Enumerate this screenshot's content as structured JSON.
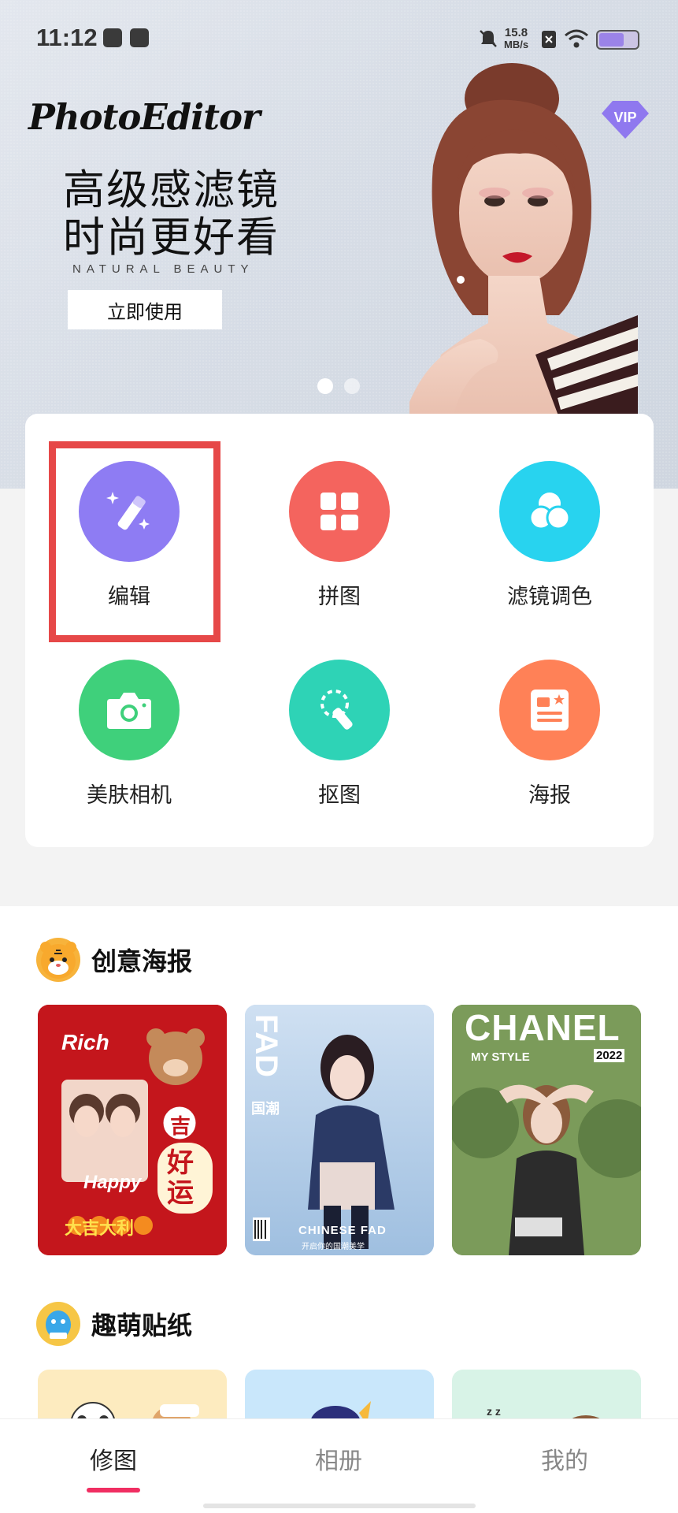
{
  "status_bar": {
    "time": "11:12",
    "net_speed_value": "15.8",
    "net_speed_unit": "MB/s"
  },
  "banner": {
    "logo": "PhotoEditor",
    "vip": "VIP",
    "headline_line1": "高级感滤镜",
    "headline_line2": "时尚更好看",
    "subline": "NATURAL  BEAUTY",
    "cta": "立即使用"
  },
  "tools": [
    {
      "label": "编辑",
      "icon": "magic-wand-icon",
      "color": "#8e7cf3"
    },
    {
      "label": "拼图",
      "icon": "collage-grid-icon",
      "color": "#f4645e"
    },
    {
      "label": "滤镜调色",
      "icon": "filter-circles-icon",
      "color": "#28d3ef"
    },
    {
      "label": "美肤相机",
      "icon": "camera-icon",
      "color": "#3fd07b"
    },
    {
      "label": "抠图",
      "icon": "cutout-icon",
      "color": "#2ed3b6"
    },
    {
      "label": "海报",
      "icon": "poster-icon",
      "color": "#ff8157"
    }
  ],
  "sections": {
    "posters_title": "创意海报",
    "stickers_title": "趣萌贴纸"
  },
  "posters": [
    {
      "name": "red-newyear-poster",
      "texts": {
        "rich": "Rich",
        "happy": "Happy",
        "ji": "吉",
        "haoyun": "好运",
        "daji": "大吉大利"
      }
    },
    {
      "name": "chinese-fad-poster",
      "texts": {
        "fad": "FAD",
        "guochao": "国潮",
        "title": "CHINESE FAD",
        "sub": "开启你的国潮美学"
      }
    },
    {
      "name": "chanel-poster",
      "texts": {
        "brand": "CHANEL",
        "style": "MY STYLE",
        "year": "2022"
      }
    }
  ],
  "tabbar": {
    "tab1": "修图",
    "tab2": "相册",
    "tab3": "我的"
  },
  "colors": {
    "accent": "#f02e62",
    "highlight": "#e64848"
  }
}
